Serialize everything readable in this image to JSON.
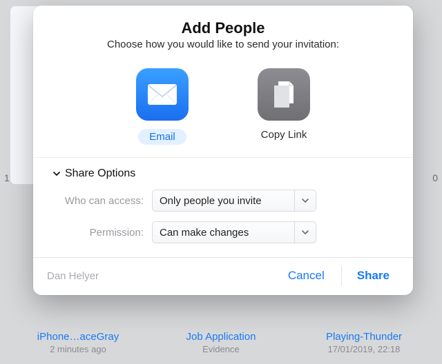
{
  "modal": {
    "title": "Add People",
    "subtitle": "Choose how you would like to send your invitation:",
    "methods": {
      "email": {
        "label": "Email",
        "icon": "mail-icon",
        "selected": true
      },
      "copy": {
        "label": "Copy Link",
        "icon": "copy-link-icon",
        "selected": false
      }
    },
    "share_options": {
      "header": "Share Options",
      "access_label": "Who can access:",
      "access_value": "Only people you invite",
      "permission_label": "Permission:",
      "permission_value": "Can make changes"
    },
    "footer": {
      "user": "Dan Helyer",
      "cancel": "Cancel",
      "share": "Share"
    }
  },
  "background": {
    "left_char": "1",
    "right_char": "0",
    "items": [
      {
        "title": "iPhone…aceGray",
        "subtitle": "2 minutes ago"
      },
      {
        "title": "Job Application",
        "subtitle": "Evidence"
      },
      {
        "title": "Playing-Thunder",
        "subtitle": "17/01/2019, 22:18"
      }
    ]
  }
}
